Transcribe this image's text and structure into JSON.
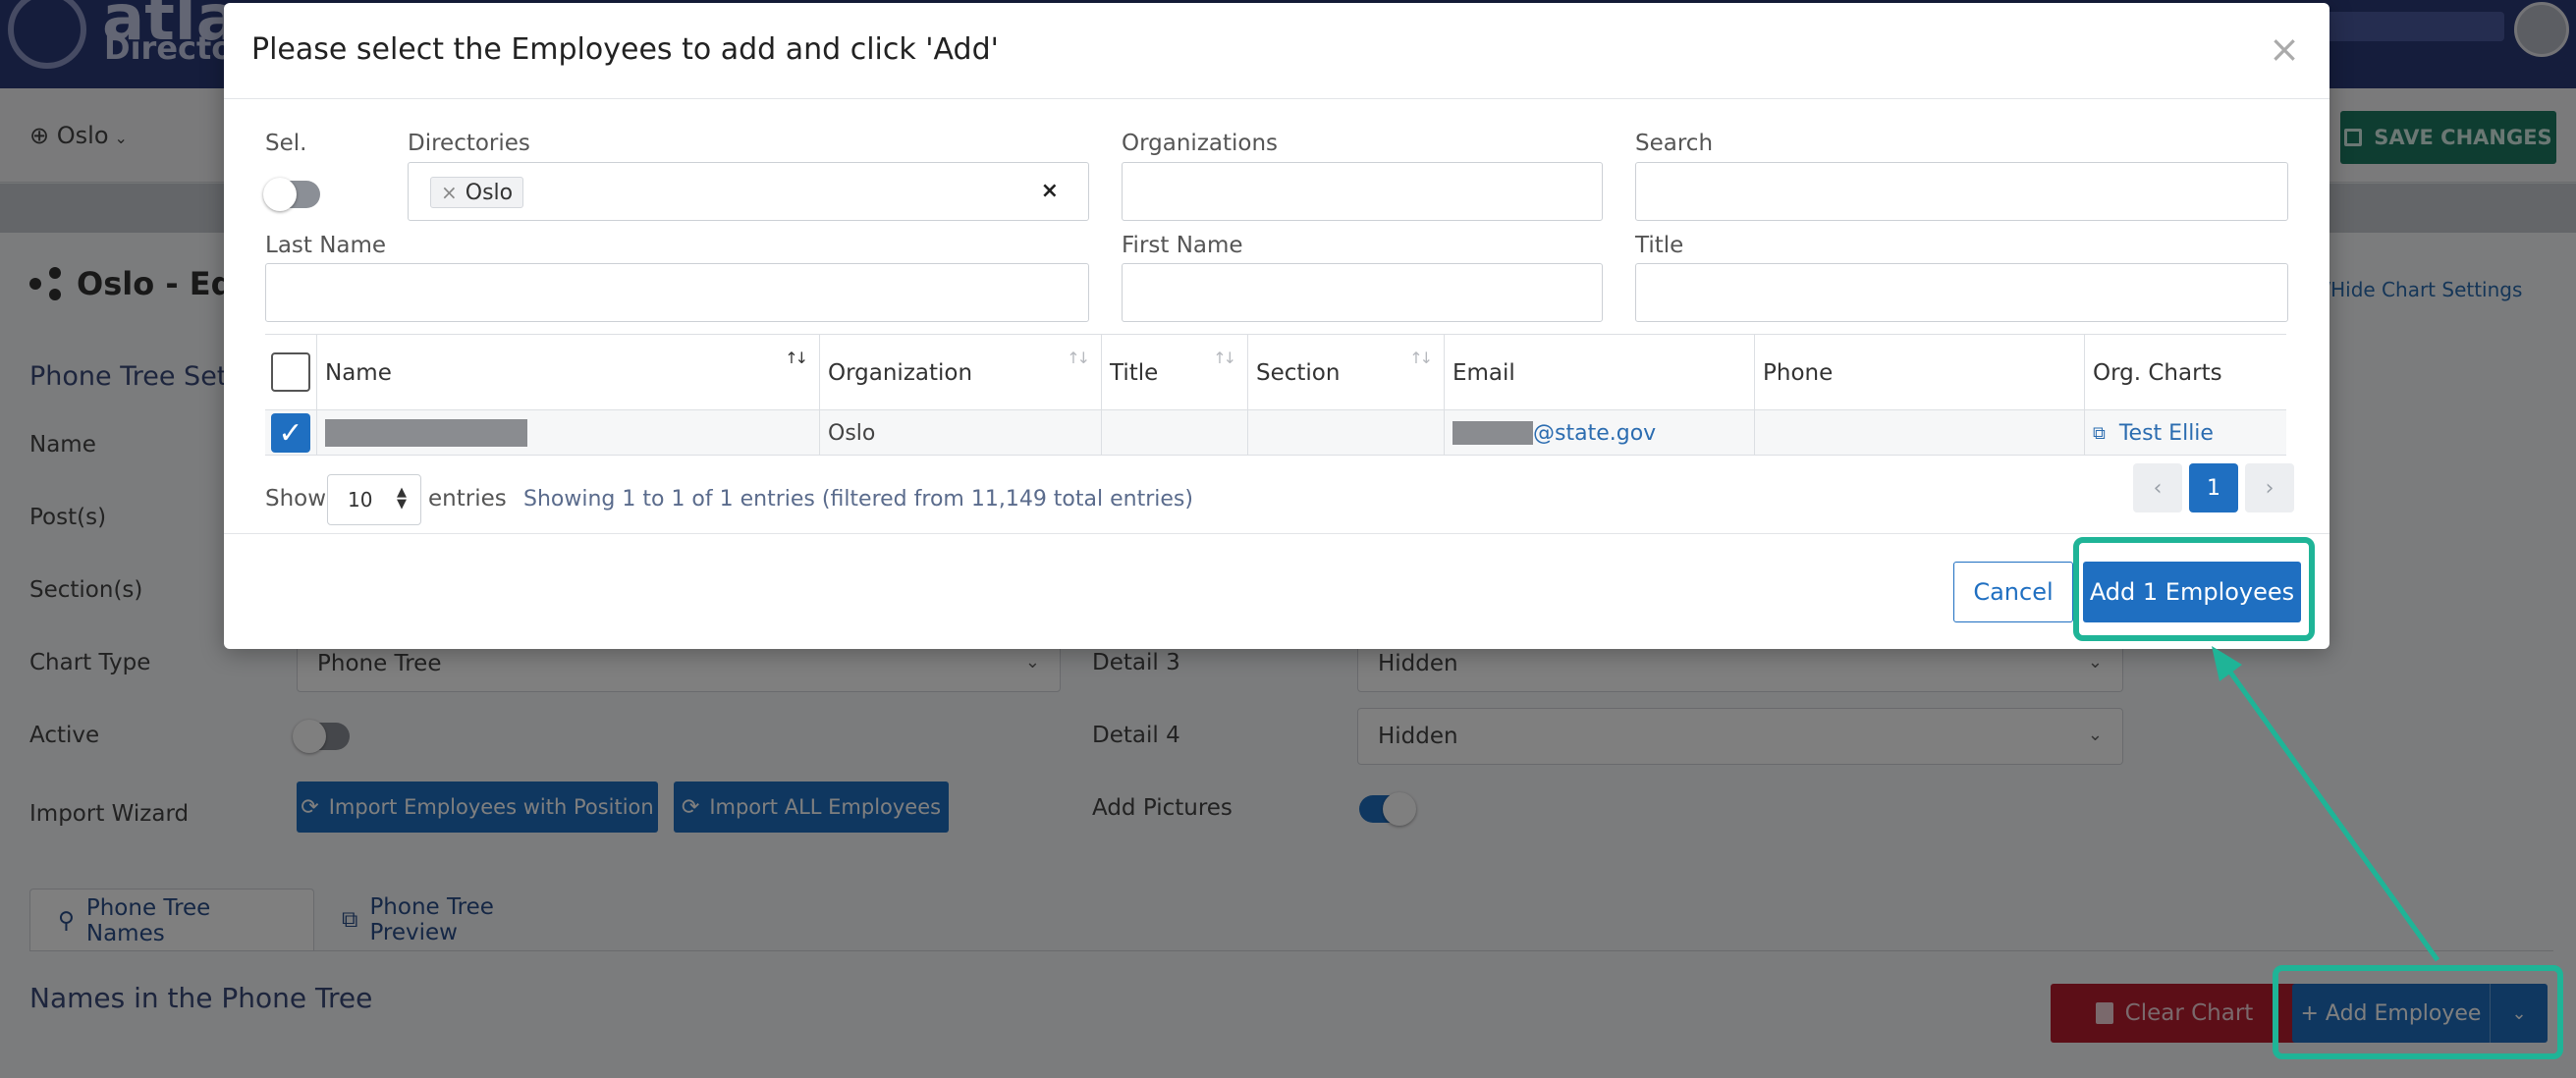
{
  "app": {
    "logo_text": "atlas",
    "logo_sub": "Director",
    "directory": "Oslo",
    "save_label": "SAVE CHANGES",
    "page_title": "Oslo - Edi",
    "show_hide": "w/Hide Chart Settings",
    "section_title": "Phone Tree Set",
    "labels": {
      "name": "Name",
      "posts": "Post(s)",
      "sections": "Section(s)",
      "chart_type": "Chart Type",
      "active": "Active",
      "import_wizard": "Import Wizard",
      "detail3": "Detail 3",
      "detail4": "Detail 4",
      "add_pictures": "Add Pictures"
    },
    "chart_type_value": "Phone Tree",
    "detail3_value": "Hidden",
    "detail4_value": "Hidden",
    "import_position_label": "Import Employees with Position",
    "import_all_label": "Import ALL Employees",
    "active_on": false,
    "add_pictures_on": true,
    "tabs": [
      {
        "label": "Phone Tree Names",
        "icon": "person-tree-icon",
        "active": true
      },
      {
        "label": "Phone Tree Preview",
        "icon": "sitemap-icon",
        "active": false
      }
    ],
    "names_title": "Names in the Phone Tree",
    "clear_chart_label": "Clear Chart",
    "add_employee_label": "+ Add Employee"
  },
  "modal": {
    "title": "Please select the Employees to add and click 'Add'",
    "close_glyph": "×",
    "filters": {
      "sel_label": "Sel.",
      "directories_label": "Directories",
      "directories_chip": "Oslo",
      "directories_clear": "×",
      "organizations_label": "Organizations",
      "search_label": "Search",
      "last_name_label": "Last Name",
      "first_name_label": "First Name",
      "title_label": "Title"
    },
    "table": {
      "columns": [
        "Name",
        "Organization",
        "Title",
        "Section",
        "Email",
        "Phone",
        "Org. Charts"
      ],
      "rows": [
        {
          "selected": true,
          "name": "",
          "organization": "Oslo",
          "title": "",
          "section": "",
          "email_visible": "@state.gov",
          "phone": "",
          "org_chart": "Test Ellie"
        }
      ]
    },
    "show_label": "Show",
    "show_value": "10",
    "entries_label": "entries",
    "info": "Showing 1 to 1 of 1 entries (filtered from 11,149 total entries)",
    "pagination": {
      "prev": "‹",
      "current": "1",
      "next": "›"
    },
    "cancel_label": "Cancel",
    "add_label": "Add 1 Employees"
  },
  "colors": {
    "primary": "#1f6fc1",
    "highlight": "#1fb497",
    "danger": "#b91c2e",
    "save": "#1d7a63",
    "topbar": "#2b3a78"
  }
}
